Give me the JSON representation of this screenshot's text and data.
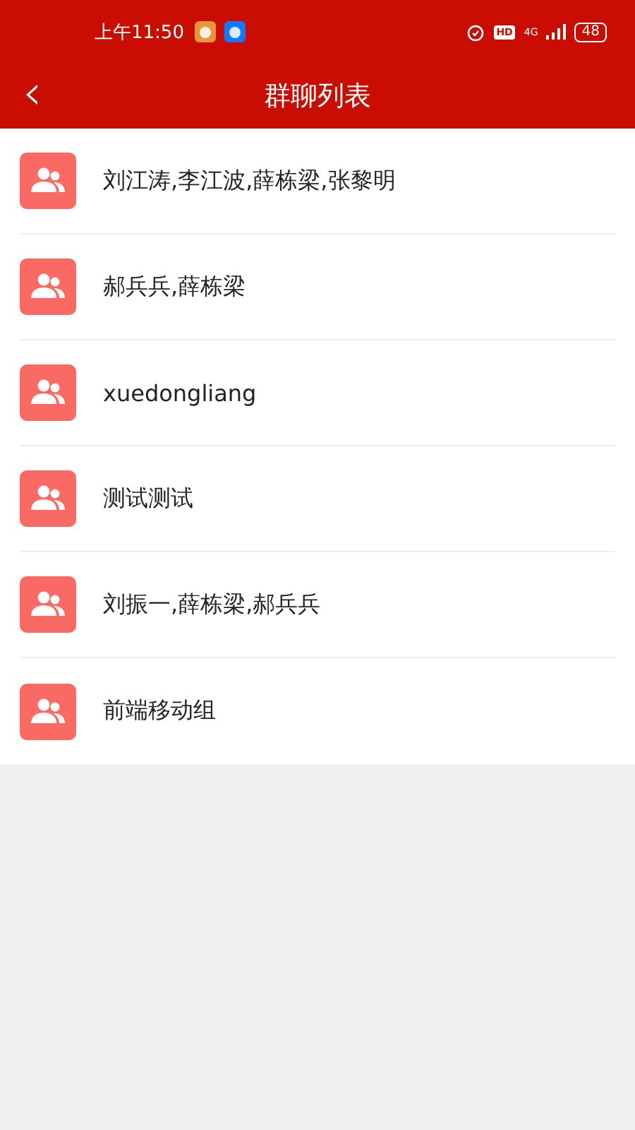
{
  "status_bar": {
    "time": "上午11:50",
    "network": "4G",
    "hd": "HD",
    "battery": "48"
  },
  "nav": {
    "back": "‹",
    "title": "群聊列表"
  },
  "groups": [
    {
      "name": "刘江涛,李江波,薛栋梁,张黎明"
    },
    {
      "name": "郝兵兵,薛栋梁"
    },
    {
      "name": "xuedongliang"
    },
    {
      "name": "测试测试"
    },
    {
      "name": "刘振一,薛栋梁,郝兵兵"
    },
    {
      "name": "前端移动组"
    }
  ]
}
